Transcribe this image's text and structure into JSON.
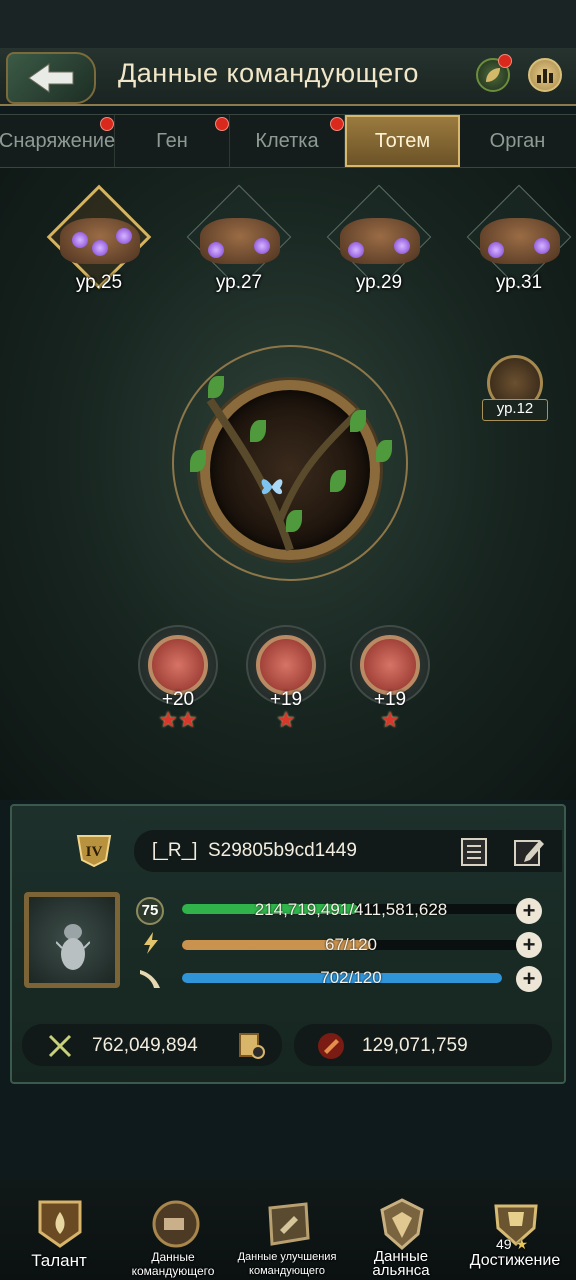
{
  "header": {
    "title": "Данные командующего"
  },
  "tabs": [
    {
      "label": "Снаряжение",
      "has_alert": true
    },
    {
      "label": "Ген",
      "has_alert": true
    },
    {
      "label": "Клетка",
      "has_alert": true
    },
    {
      "label": "Тотем",
      "active": true
    },
    {
      "label": "Орган"
    }
  ],
  "totems": [
    {
      "level": "ур.25",
      "selected": true
    },
    {
      "level": "ур.27"
    },
    {
      "level": "ур.29"
    },
    {
      "level": "ур.31"
    }
  ],
  "side_totem": {
    "level": "ур.12"
  },
  "runes": [
    {
      "value": "+20",
      "stars": 2
    },
    {
      "value": "+19",
      "stars": 1
    },
    {
      "value": "+19",
      "stars": 1
    }
  ],
  "player": {
    "name": "[_R_]  S29805b9cd1449",
    "level": "75",
    "exp_text": "214,719,491/411,581,628",
    "exp_fraction": 0.52,
    "energy_text": "67/120",
    "energy_fraction": 0.56,
    "stamina_text": "702/120",
    "stamina_fraction": 1.0,
    "power": "762,049,894",
    "kills": "129,071,759"
  },
  "colors": {
    "exp": "#2fb34a",
    "energy": "#c9934f",
    "stamina": "#2f94d8",
    "accent": "#d6b45f"
  },
  "bottom_nav": [
    {
      "label": "Талант",
      "icon": "talent-crest-icon"
    },
    {
      "label": "Данные командующего",
      "icon": "commander-icon"
    },
    {
      "label": "Данные улучшения командующего",
      "icon": "upgrade-icon"
    },
    {
      "label": "Данные альянса",
      "icon": "alliance-shield-icon"
    },
    {
      "label": "Достижение",
      "icon": "trophy-icon",
      "count": "49"
    }
  ]
}
